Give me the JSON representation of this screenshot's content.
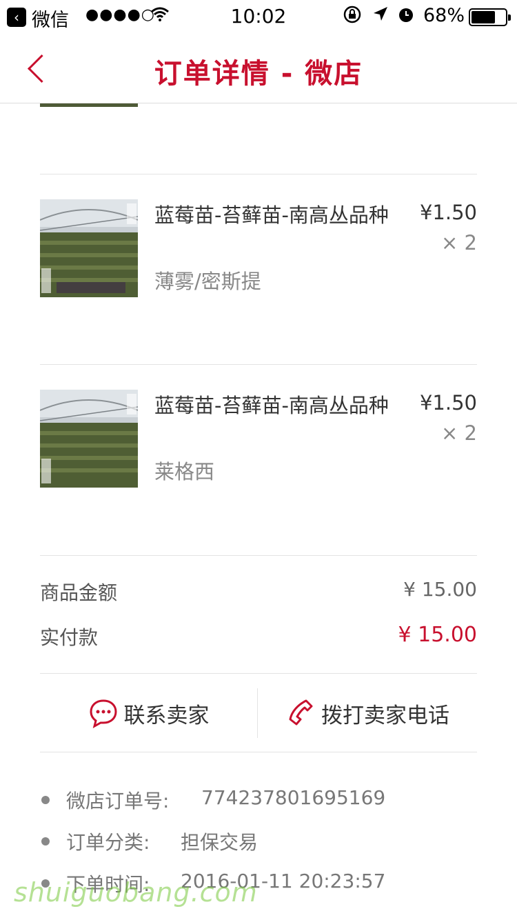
{
  "status_bar": {
    "app": "微信",
    "signal": "●●●●○",
    "time": "10:02",
    "battery": "68%"
  },
  "nav": {
    "title": "订单详情 - 微店"
  },
  "items": [
    {
      "name": "蓝莓苗-苔藓苗-南高丛品种",
      "spec": "薄雾/密斯提",
      "price": "¥1.50",
      "qty": "× 2"
    },
    {
      "name": "蓝莓苗-苔藓苗-南高丛品种",
      "spec": "莱格西",
      "price": "¥1.50",
      "qty": "× 2"
    }
  ],
  "summary": {
    "goods_label": "商品金额",
    "goods_value": "¥ 15.00",
    "paid_label": "实付款",
    "paid_value": "¥ 15.00"
  },
  "actions": {
    "contact_seller": "联系卖家",
    "call_seller": "拨打卖家电话"
  },
  "order_info": [
    {
      "key": "微店订单号:",
      "value": "774237801695169"
    },
    {
      "key": "订单分类:",
      "value": "担保交易"
    },
    {
      "key": "下单时间:",
      "value": "2016-01-11 20:23:57"
    }
  ],
  "watermark": "shuiguobang.com",
  "colors": {
    "accent": "#c8102e"
  }
}
